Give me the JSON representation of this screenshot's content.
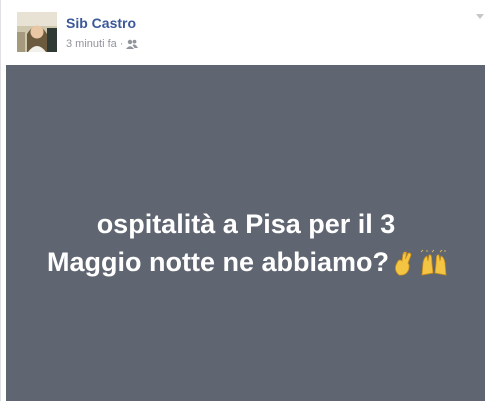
{
  "post": {
    "author_name": "Sib Castro",
    "timestamp": "3 minuti fa",
    "separator": "·",
    "audience_icon": "friends-icon",
    "text_line1": "ospitalità a Pisa per il 3",
    "text_line2": "Maggio notte ne abbiamo?",
    "emojis": [
      "crossed-fingers-emoji",
      "raising-hands-emoji"
    ],
    "background_color": "#5f6571",
    "author_color": "#3b5998"
  }
}
